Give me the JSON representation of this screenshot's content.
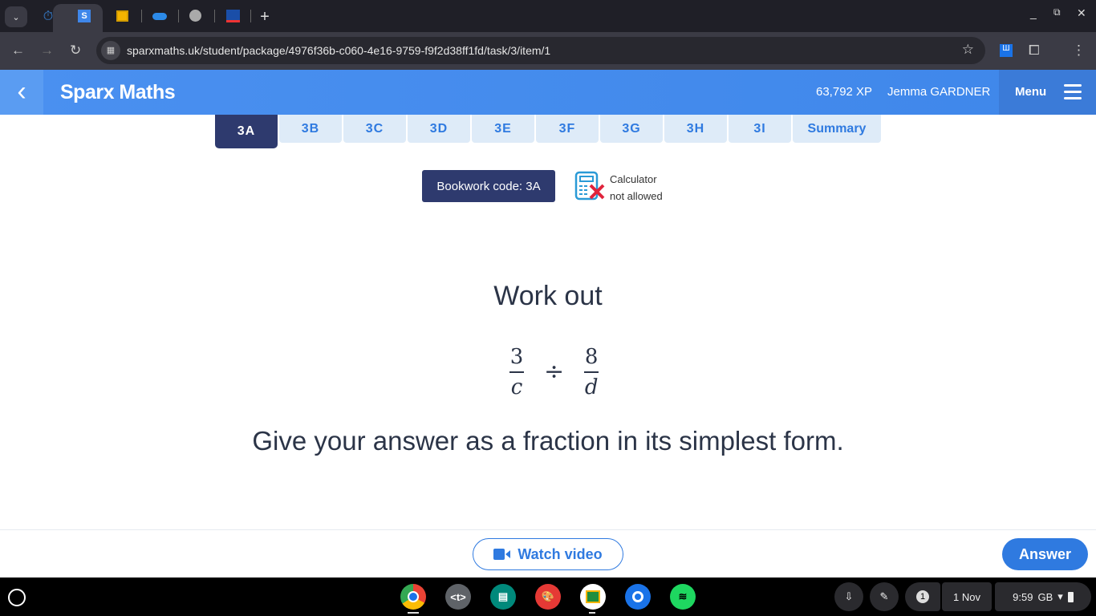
{
  "browser": {
    "tabs": [
      {
        "icon": "timer-icon"
      },
      {
        "icon": "sparx-s-icon",
        "active": true,
        "label": "S"
      },
      {
        "icon": "classroom-icon"
      },
      {
        "icon": "onedrive-icon"
      },
      {
        "icon": "globe-icon"
      },
      {
        "icon": "flag-icon"
      }
    ],
    "new_tab": "+",
    "url": "sparxmaths.uk/student/package/4976f36b-c060-4e16-9759-f9f2d38ff1fd/task/3/item/1"
  },
  "header": {
    "brand": "Sparx Maths",
    "xp": "63,792 XP",
    "user": "Jemma GARDNER",
    "menu": "Menu",
    "color": "#4289ea"
  },
  "task_tabs": [
    {
      "label": "3A",
      "active": true
    },
    {
      "label": "3B"
    },
    {
      "label": "3C"
    },
    {
      "label": "3D"
    },
    {
      "label": "3E"
    },
    {
      "label": "3F"
    },
    {
      "label": "3G"
    },
    {
      "label": "3H"
    },
    {
      "label": "3I"
    },
    {
      "label": "Summary"
    }
  ],
  "bookwork": "Bookwork code: 3A",
  "calculator": {
    "line1": "Calculator",
    "line2": "not allowed"
  },
  "question": {
    "prompt": "Work out",
    "num1": "3",
    "den1": "c",
    "op": "÷",
    "num2": "8",
    "den2": "d",
    "instruction": "Give your answer as a fraction in its simplest form."
  },
  "footer": {
    "watch_video": "Watch video",
    "answer": "Answer"
  },
  "shelf": {
    "date": "1 Nov",
    "time": "9:59",
    "region": "GB",
    "notifications": "1"
  }
}
